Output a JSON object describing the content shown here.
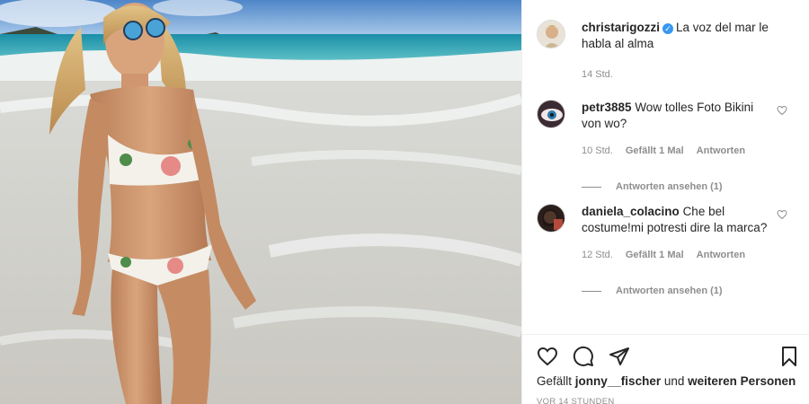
{
  "post": {
    "author": "christarigozzi",
    "caption": "La voz del mar le habla al alma",
    "time": "14 Std."
  },
  "comments": [
    {
      "user": "petr3885",
      "text": "Wow tolles Foto Bikini von wo?",
      "time": "10 Std.",
      "likes": "Gefällt 1 Mal",
      "reply_label": "Antworten",
      "view_replies": "Antworten ansehen (1)"
    },
    {
      "user": "daniela_colacino",
      "text": "Che bel costume!mi potresti dire la marca?",
      "time": "12 Std.",
      "likes": "Gefällt 1 Mal",
      "reply_label": "Antworten",
      "view_replies": "Antworten ansehen (1)"
    }
  ],
  "icons": {
    "like": "heart-icon",
    "comment": "comment-icon",
    "share": "paper-plane-icon",
    "save": "bookmark-icon",
    "verified": "verified-badge-icon"
  },
  "footer": {
    "likes_prefix": "Gefällt",
    "liked_by": "jonny__fischer",
    "likes_mid": "und",
    "likes_suffix": "weiteren Personen",
    "timestamp": "VOR 14 STUNDEN"
  },
  "colors": {
    "verified": "#3897f0",
    "text": "#262626",
    "muted": "#8e8e8e"
  }
}
